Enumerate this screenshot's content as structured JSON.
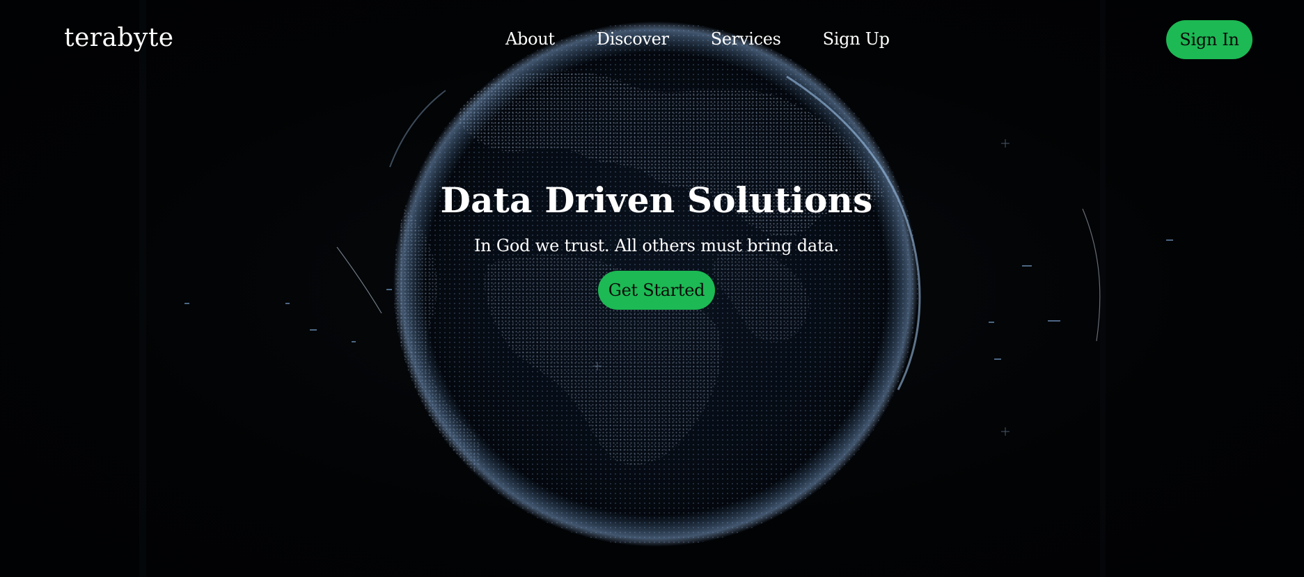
{
  "brand": {
    "name": "terabyte"
  },
  "nav": {
    "links": [
      {
        "label": "About"
      },
      {
        "label": "Discover"
      },
      {
        "label": "Services"
      },
      {
        "label": "Sign Up"
      }
    ],
    "signin_label": "Sign In"
  },
  "hero": {
    "title": "Data Driven Solutions",
    "subtitle": "In God we trust. All others must bring data.",
    "cta_label": "Get Started",
    "background": "digital-globe-earth-image"
  },
  "colors": {
    "background": "#020304",
    "accent": "#1db954",
    "text": "#ffffff",
    "globe_dots": "#9ec8ff"
  }
}
